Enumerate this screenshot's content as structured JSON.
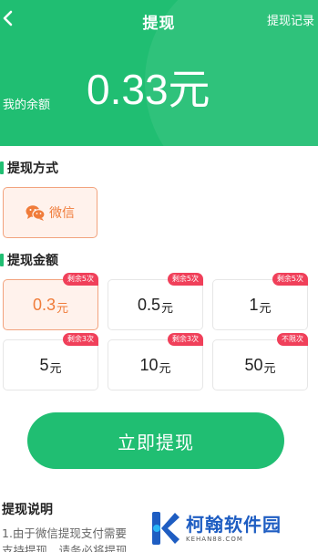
{
  "header": {
    "title": "提现",
    "history_link": "提现记录",
    "balance_label": "我的余额",
    "balance_amount": "0.33元"
  },
  "method_section": {
    "title": "提现方式",
    "methods": [
      {
        "label": "微信",
        "icon": "wechat-icon",
        "selected": true
      }
    ]
  },
  "amount_section": {
    "title": "提现金额",
    "options": [
      {
        "value": "0.3",
        "unit": "元",
        "badge": "剩余5次",
        "selected": true
      },
      {
        "value": "0.5",
        "unit": "元",
        "badge": "剩余5次",
        "selected": false
      },
      {
        "value": "1",
        "unit": "元",
        "badge": "剩余5次",
        "selected": false
      },
      {
        "value": "5",
        "unit": "元",
        "badge": "剩余3次",
        "selected": false
      },
      {
        "value": "10",
        "unit": "元",
        "badge": "剩余3次",
        "selected": false
      },
      {
        "value": "50",
        "unit": "元",
        "badge": "不限次",
        "selected": false
      }
    ]
  },
  "submit_label": "立即提现",
  "notes": {
    "title": "提现说明",
    "lines": [
      "1.由于微信提现支付需要",
      "支持提现，请务必将提现"
    ]
  },
  "watermark": {
    "name": "柯翰软件园",
    "domain": "KEHAN88.COM"
  },
  "colors": {
    "primary": "#20be72",
    "accent": "#f07c3a",
    "badge": "#f0405a",
    "brand_blue": "#1e5dc2"
  }
}
